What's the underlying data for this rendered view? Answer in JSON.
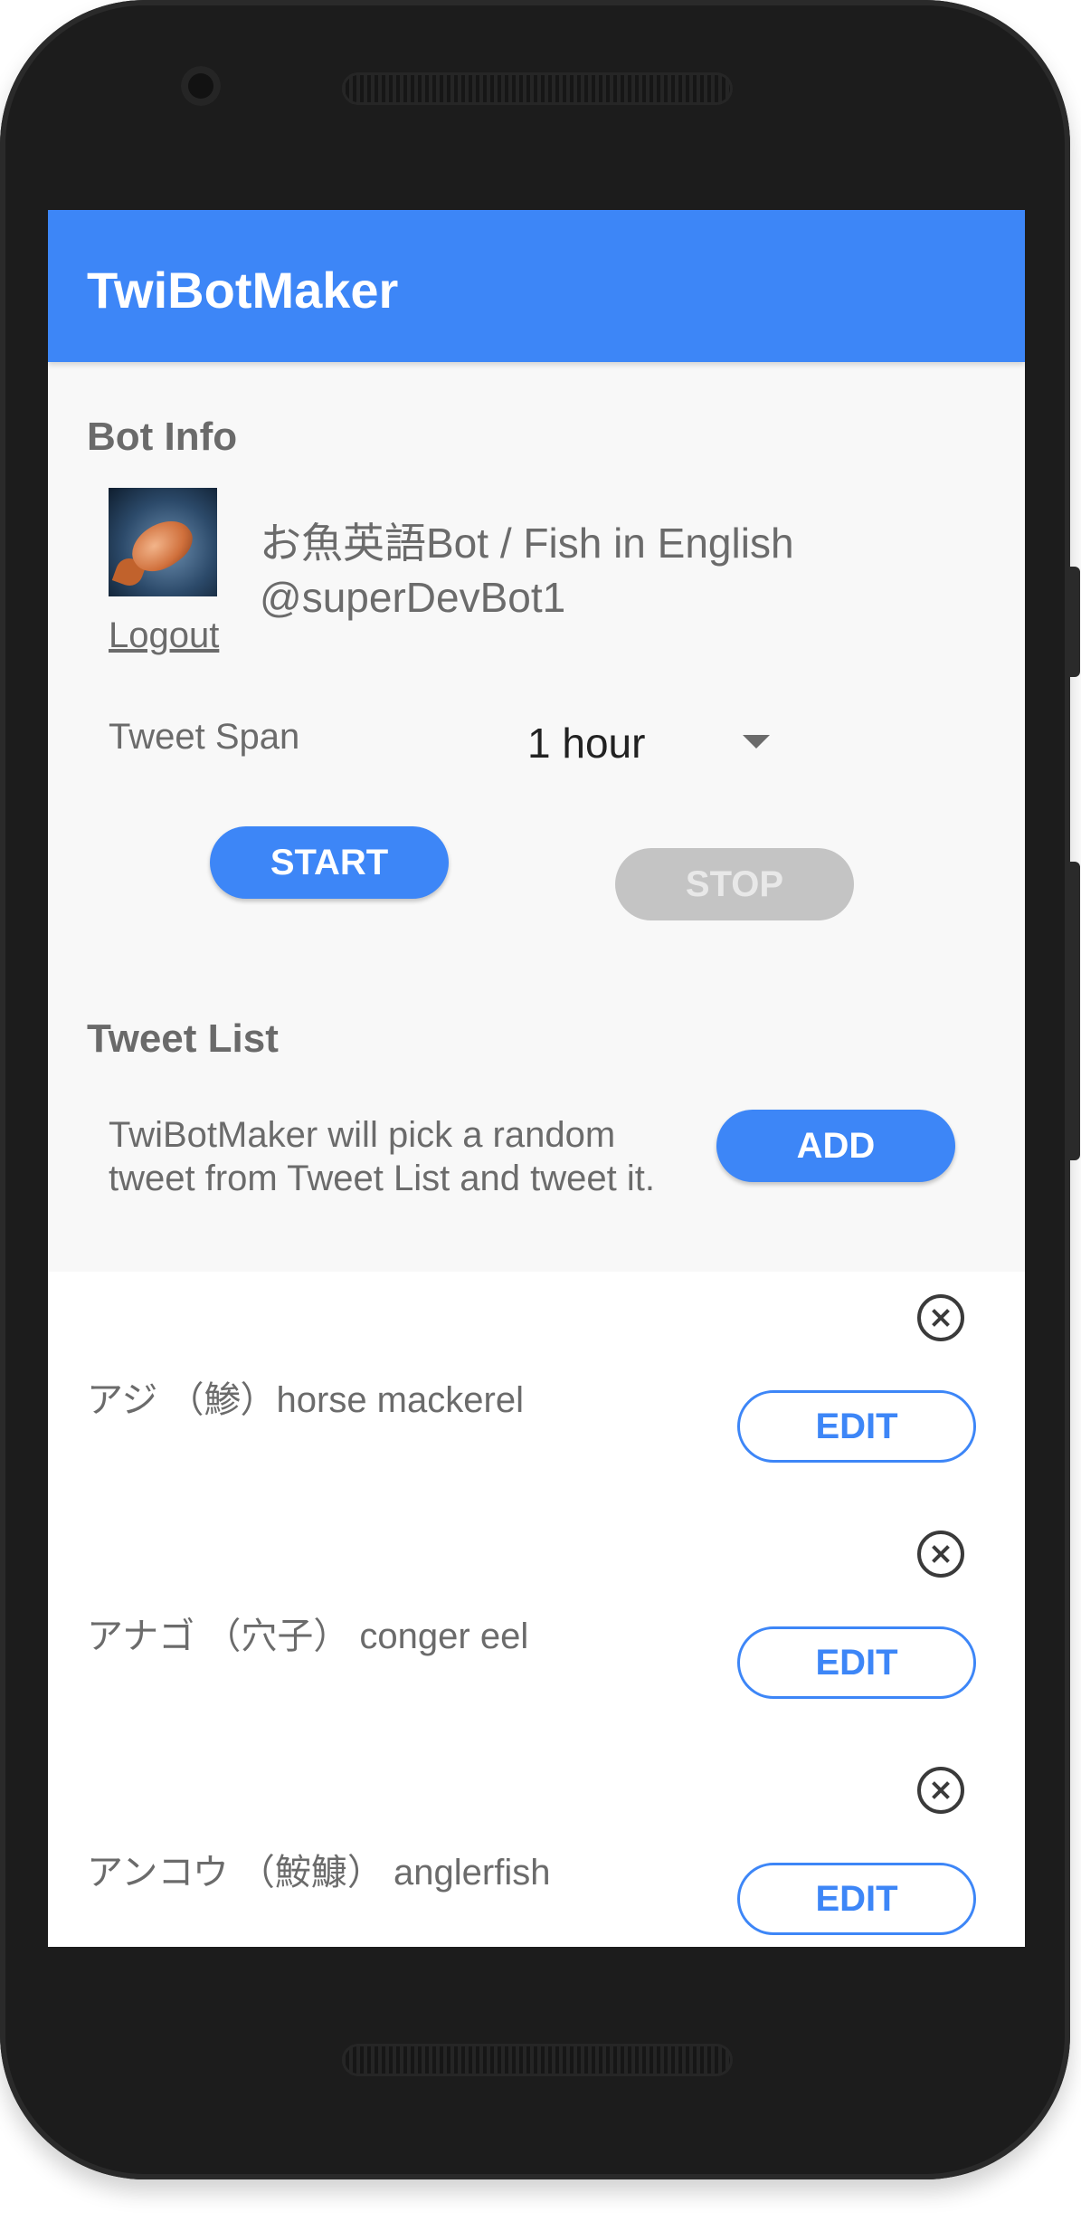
{
  "app": {
    "title": "TwiBotMaker"
  },
  "bot_info": {
    "section_title": "Bot Info",
    "name": "お魚英語Bot / Fish in English",
    "handle": "@superDevBot1",
    "logout_label": "Logout",
    "avatar_icon": "fish-avatar-icon"
  },
  "tweet_span": {
    "label": "Tweet Span",
    "selected": "1 hour"
  },
  "controls": {
    "start_label": "START",
    "stop_label": "STOP"
  },
  "tweet_list": {
    "section_title": "Tweet List",
    "description_line1": "TwiBotMaker will pick a random",
    "description_line2": "tweet from Tweet List and tweet it.",
    "add_label": "ADD",
    "items": [
      {
        "text": "アジ （鯵）horse mackerel",
        "edit_label": "EDIT"
      },
      {
        "text": "アナゴ （穴子） conger eel",
        "edit_label": "EDIT"
      },
      {
        "text": "アンコウ （鮟鱇） anglerfish",
        "edit_label": "EDIT"
      }
    ]
  },
  "colors": {
    "accent": "#3d86f7",
    "disabled": "#c4c4c4",
    "text_secondary": "#6b6b6b"
  }
}
